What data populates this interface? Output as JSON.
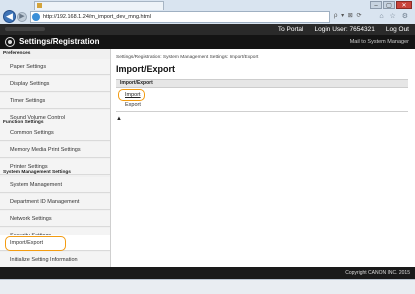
{
  "browser": {
    "url": "http://192.168.1.24/m_import_dev_mng.html",
    "tab_title": "",
    "window_controls": [
      "–",
      "▢",
      "✕"
    ],
    "back_icon": "back-arrow-icon",
    "forward_icon": "forward-arrow-icon",
    "tools_text": "ρ ▾ ⊠ ⟳",
    "right_icons": "⌂ ☆ ⚙"
  },
  "header": {
    "links": [
      "To Portal",
      "Login User:  7654321",
      "Log Out"
    ],
    "app_title": "Settings/Registration",
    "mail_link": "Mail to System Manager"
  },
  "sidebar": {
    "preferences": {
      "heading": "Preferences",
      "items": [
        "Paper Settings",
        "Display Settings",
        "Timer Settings",
        "Sound Volume Control"
      ]
    },
    "function": {
      "heading": "Function Settings",
      "items": [
        "Common Settings",
        "Memory Media Print Settings",
        "Printer Settings"
      ]
    },
    "system": {
      "heading": "System Management Settings",
      "items": [
        "System Management",
        "Department ID Management",
        "Network Settings",
        "Security Settings",
        "Import/Export",
        "Initialize Setting Information"
      ]
    }
  },
  "main": {
    "breadcrumb": "Settings/Registration: System Management Settings: Import/Export",
    "title": "Import/Export",
    "section": "Import/Export",
    "import_link": "Import",
    "export_link": "Export",
    "top_arrow": "▲"
  },
  "footer": {
    "copyright": "Copyright CANON INC. 2015"
  },
  "colors": {
    "highlight": "#f39c12",
    "header_bg": "#141414"
  }
}
